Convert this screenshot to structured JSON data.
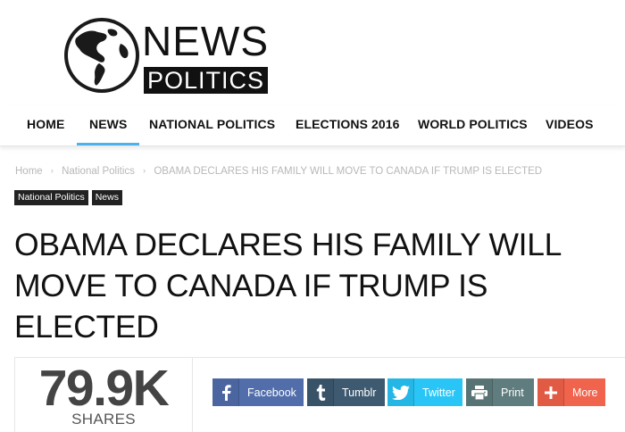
{
  "logo": {
    "news": "NEWS",
    "politics": "POLITICS"
  },
  "nav": {
    "items": [
      {
        "label": "HOME"
      },
      {
        "label": "NEWS"
      },
      {
        "label": "NATIONAL POLITICS"
      },
      {
        "label": "ELECTIONS 2016"
      },
      {
        "label": "WORLD POLITICS"
      },
      {
        "label": "VIDEOS"
      }
    ],
    "active": "NEWS",
    "accent_color": "#4db2ec"
  },
  "breadcrumb": {
    "items": [
      "Home",
      "National Politics",
      "OBAMA DECLARES HIS FAMILY WILL MOVE TO CANADA IF TRUMP IS ELECTED"
    ],
    "separator": "›"
  },
  "tags": [
    "National Politics",
    "News"
  ],
  "article": {
    "title": "OBAMA DECLARES HIS FAMILY WILL MOVE TO CANADA IF TRUMP IS ELECTED"
  },
  "shares": {
    "count": "79.9K",
    "label": "SHARES"
  },
  "share_buttons": [
    {
      "label": "Facebook",
      "icon": "facebook-icon",
      "color": "#516eab",
      "icon_bg": "#4a65a0"
    },
    {
      "label": "Tumblr",
      "icon": "tumblr-icon",
      "color": "#3e5a70",
      "icon_bg": "#385268"
    },
    {
      "label": "Twitter",
      "icon": "twitter-icon",
      "color": "#29c5f6",
      "icon_bg": "#24b6e4"
    },
    {
      "label": "Print",
      "icon": "print-icon",
      "color": "#5f7d7e",
      "icon_bg": "#577374"
    },
    {
      "label": "More",
      "icon": "plus-icon",
      "color": "#f0634c",
      "icon_bg": "#e15a44"
    }
  ]
}
